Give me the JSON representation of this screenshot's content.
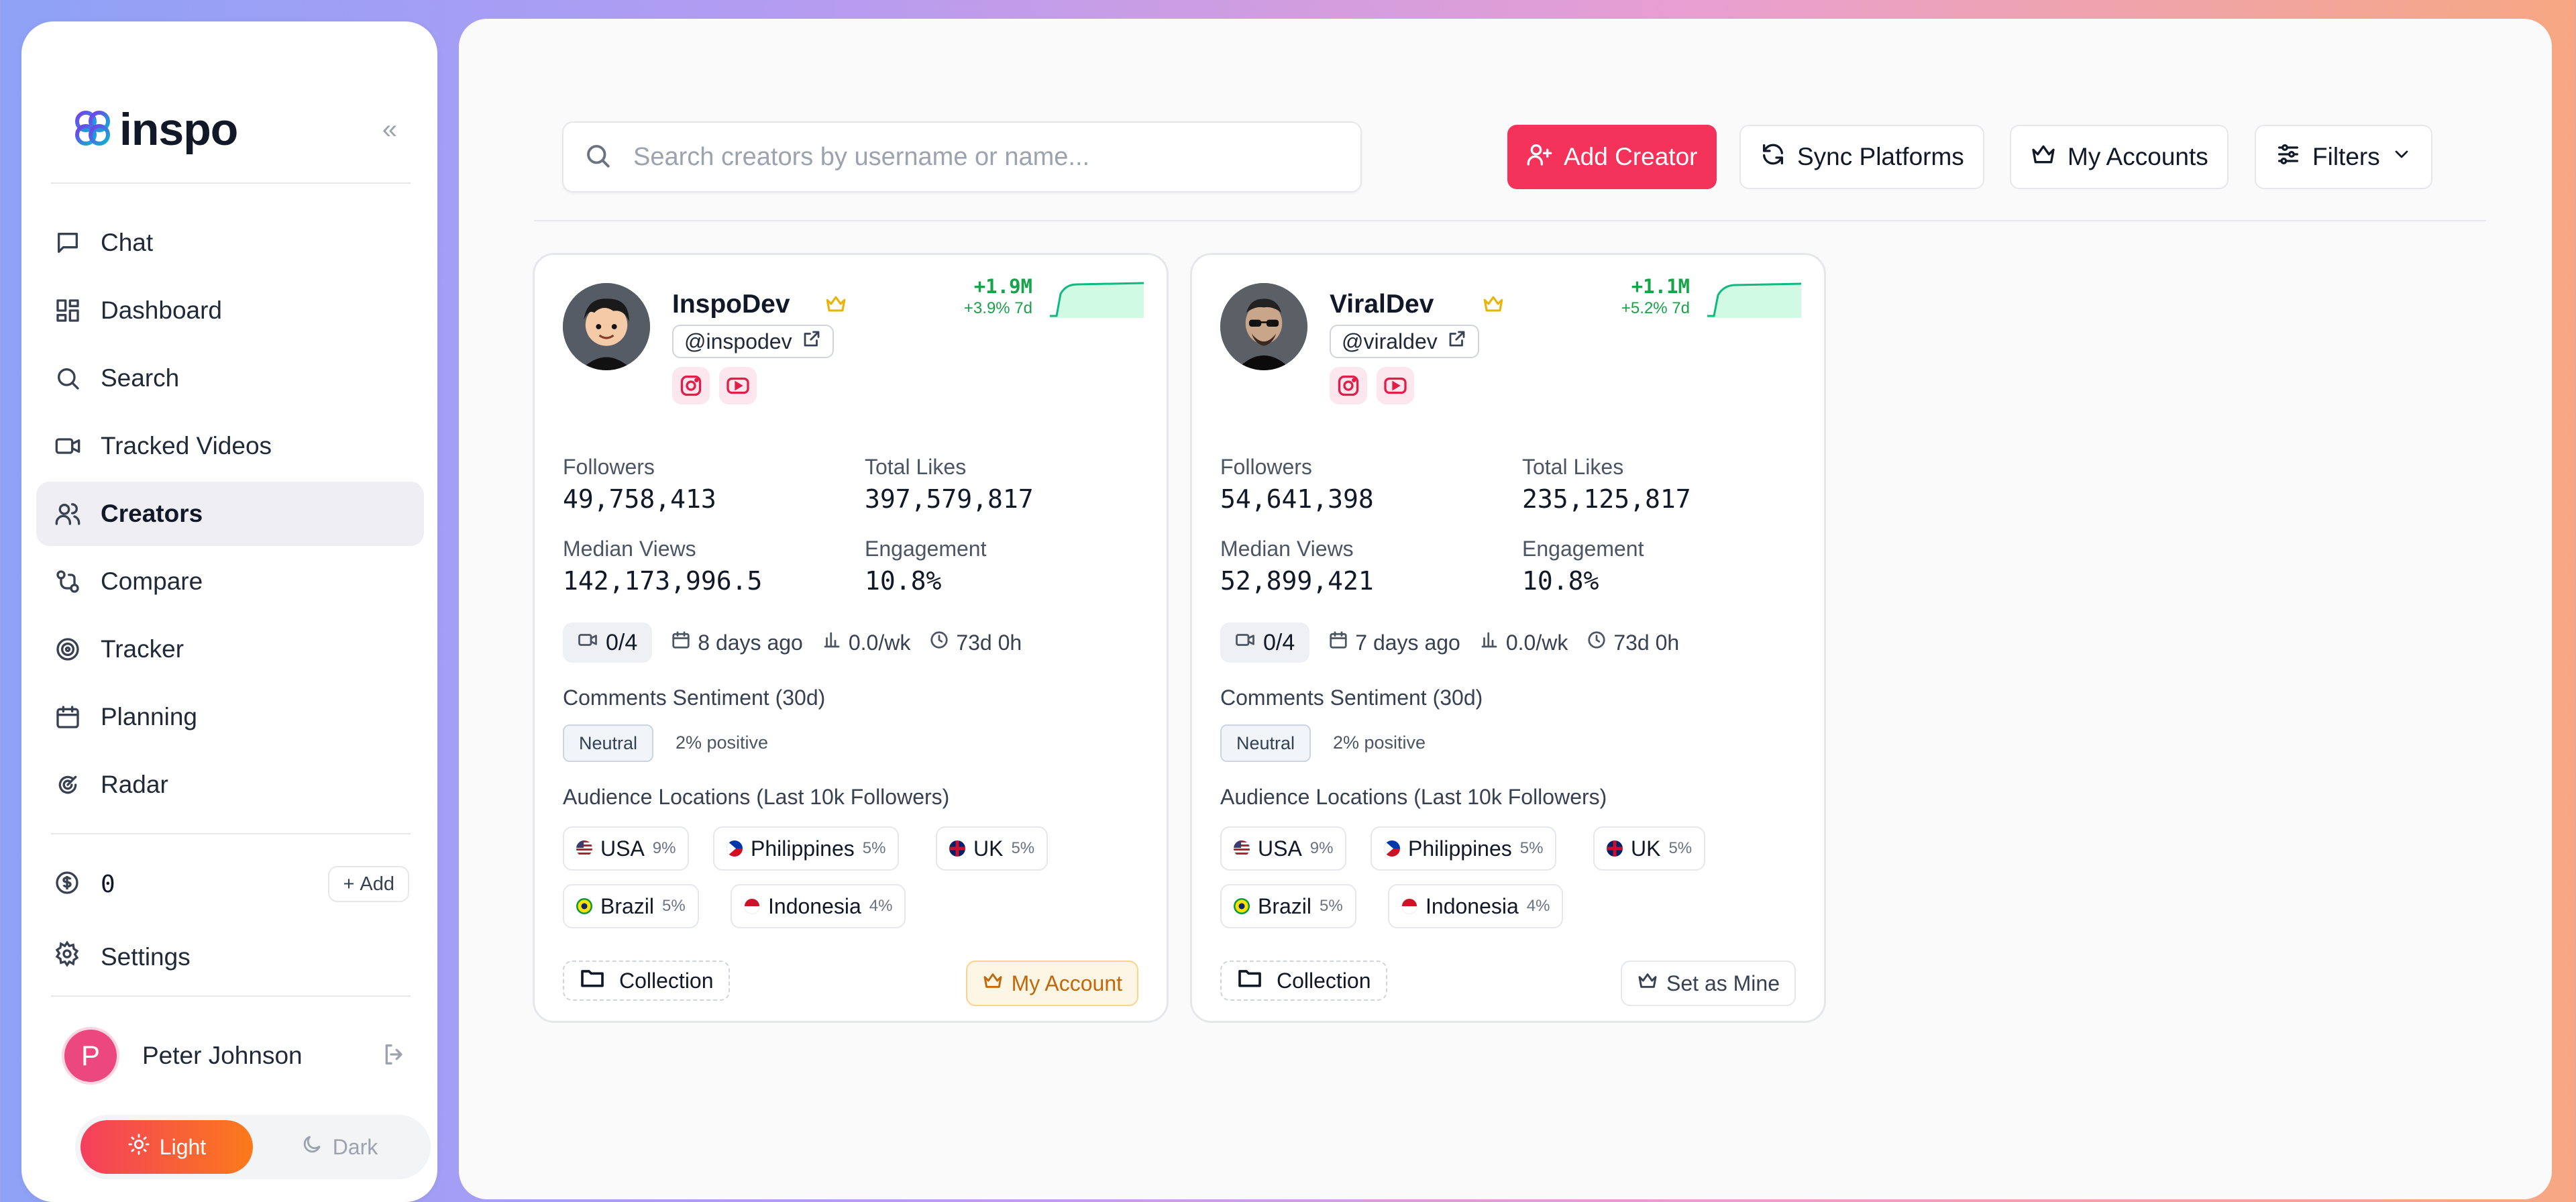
{
  "app": {
    "logo_text": "inspo"
  },
  "sidebar": {
    "items": [
      {
        "label": "Chat",
        "icon": "chat-icon"
      },
      {
        "label": "Dashboard",
        "icon": "dashboard-icon"
      },
      {
        "label": "Search",
        "icon": "search-icon"
      },
      {
        "label": "Tracked Videos",
        "icon": "video-icon"
      },
      {
        "label": "Creators",
        "icon": "users-icon",
        "active": true
      },
      {
        "label": "Compare",
        "icon": "compare-icon"
      },
      {
        "label": "Tracker",
        "icon": "target-icon"
      },
      {
        "label": "Planning",
        "icon": "calendar-icon"
      },
      {
        "label": "Radar",
        "icon": "radar-icon"
      }
    ],
    "credits": {
      "value": "0",
      "add_label": "Add"
    },
    "settings_label": "Settings",
    "user": {
      "initial": "P",
      "name": "Peter Johnson"
    },
    "theme": {
      "light_label": "Light",
      "dark_label": "Dark",
      "selected": "Light"
    }
  },
  "toolbar": {
    "search_placeholder": "Search creators by username or name...",
    "add_creator_label": "Add Creator",
    "sync_label": "Sync Platforms",
    "accounts_label": "My Accounts",
    "filters_label": "Filters"
  },
  "labels": {
    "followers": "Followers",
    "total_likes": "Total Likes",
    "median_views": "Median Views",
    "engagement": "Engagement",
    "sentiment_title": "Comments Sentiment (30d)",
    "audience_title": "Audience Locations (Last 10k Followers)",
    "collection": "Collection"
  },
  "creators": [
    {
      "name": "InspoDev",
      "handle": "@inspodev",
      "growth": "+1.9M",
      "growth_rate": "+3.9% 7d",
      "followers": "49,758,413",
      "total_likes": "397,579,817",
      "median_views": "142,173,996.5",
      "engagement": "10.8%",
      "videos": "0/4",
      "last_seen": "8 days ago",
      "rate": "0.0/wk",
      "age": "73d 0h",
      "sentiment": "Neutral",
      "positive": "2% positive",
      "locations": [
        {
          "country": "USA",
          "pct": "9%"
        },
        {
          "country": "Philippines",
          "pct": "5%"
        },
        {
          "country": "UK",
          "pct": "5%"
        },
        {
          "country": "Brazil",
          "pct": "5%"
        },
        {
          "country": "Indonesia",
          "pct": "4%"
        }
      ],
      "account_action": "My Account"
    },
    {
      "name": "ViralDev",
      "handle": "@viraldev",
      "growth": "+1.1M",
      "growth_rate": "+5.2% 7d",
      "followers": "54,641,398",
      "total_likes": "235,125,817",
      "median_views": "52,899,421",
      "engagement": "10.8%",
      "videos": "0/4",
      "last_seen": "7 days ago",
      "rate": "0.0/wk",
      "age": "73d 0h",
      "sentiment": "Neutral",
      "positive": "2% positive",
      "locations": [
        {
          "country": "USA",
          "pct": "9%"
        },
        {
          "country": "Philippines",
          "pct": "5%"
        },
        {
          "country": "UK",
          "pct": "5%"
        },
        {
          "country": "Brazil",
          "pct": "5%"
        },
        {
          "country": "Indonesia",
          "pct": "4%"
        }
      ],
      "account_action": "Set as Mine"
    }
  ],
  "colors": {
    "accent": "#f4335a",
    "growth_green": "#16a34a",
    "crown_gold": "#eab308",
    "active_nav_bg": "#eeeef3"
  }
}
